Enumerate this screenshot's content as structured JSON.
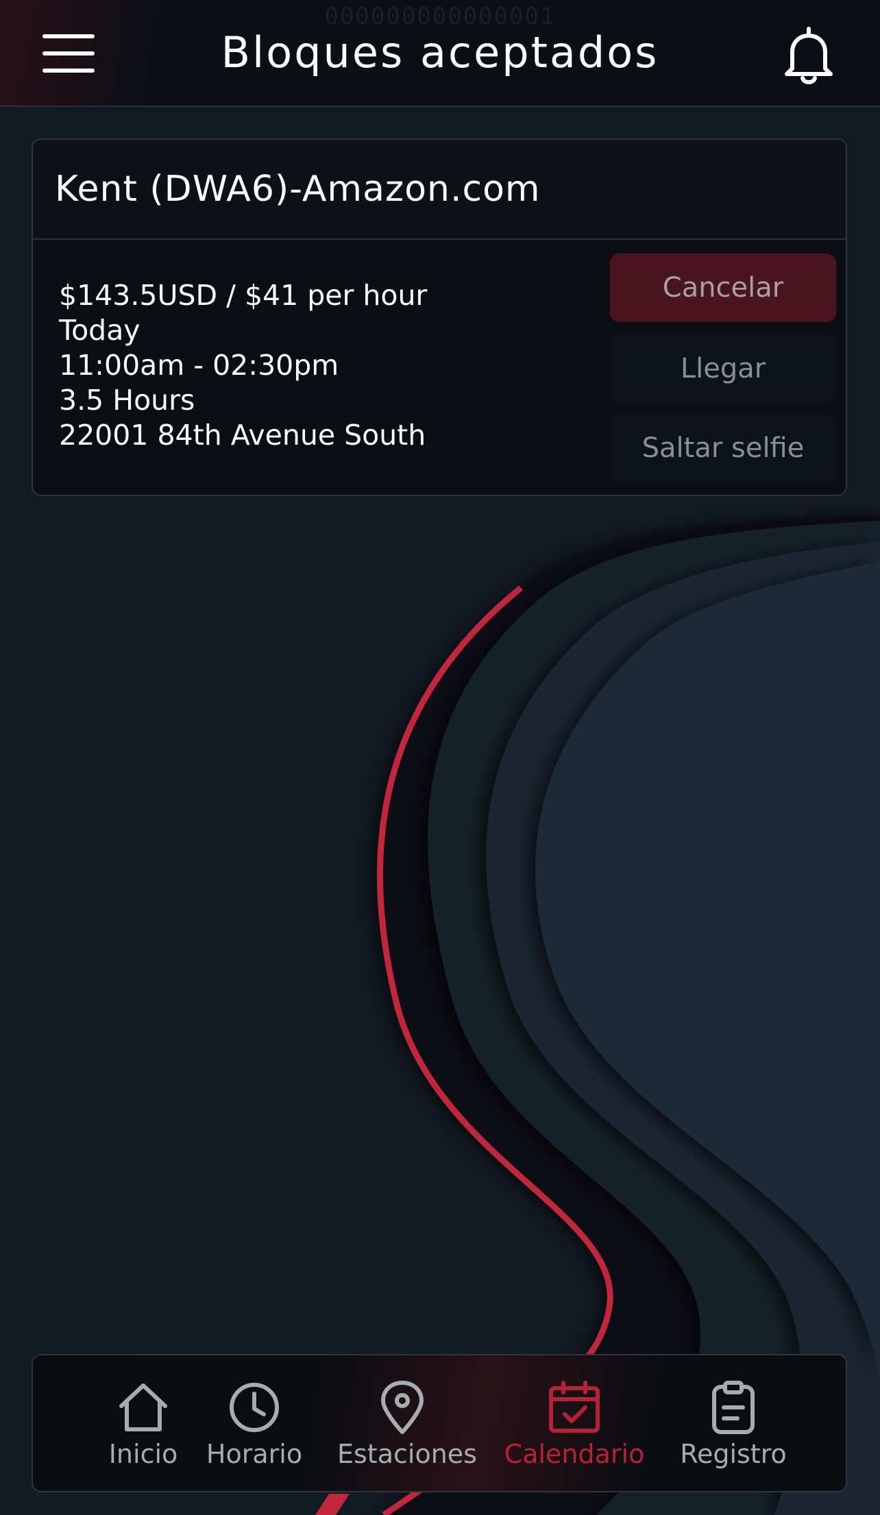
{
  "header": {
    "ghost_text": "000000000000001",
    "title": "Bloques aceptados",
    "menu_icon": "hamburger-menu-icon",
    "bell_icon": "bell-icon"
  },
  "block": {
    "station": "Kent (DWA6)-Amazon.com",
    "pay": "$143.5USD / $41 per hour",
    "day": "Today",
    "time": "11:00am - 02:30pm",
    "duration": "3.5 Hours",
    "address": "22001 84th Avenue South",
    "actions": {
      "cancel": "Cancelar",
      "arrive": "Llegar",
      "skip_selfie": "Saltar selfie"
    }
  },
  "nav": {
    "items": [
      {
        "label": "Inicio",
        "icon": "home-icon"
      },
      {
        "label": "Horario",
        "icon": "clock-icon"
      },
      {
        "label": "Estaciones",
        "icon": "map-pin-icon"
      },
      {
        "label": "Calendario",
        "icon": "calendar-check-icon",
        "active": true
      },
      {
        "label": "Registro",
        "icon": "clipboard-icon"
      }
    ]
  },
  "colors": {
    "accent": "#b72238",
    "background": "#121a22",
    "surface": "#0b0f13"
  }
}
